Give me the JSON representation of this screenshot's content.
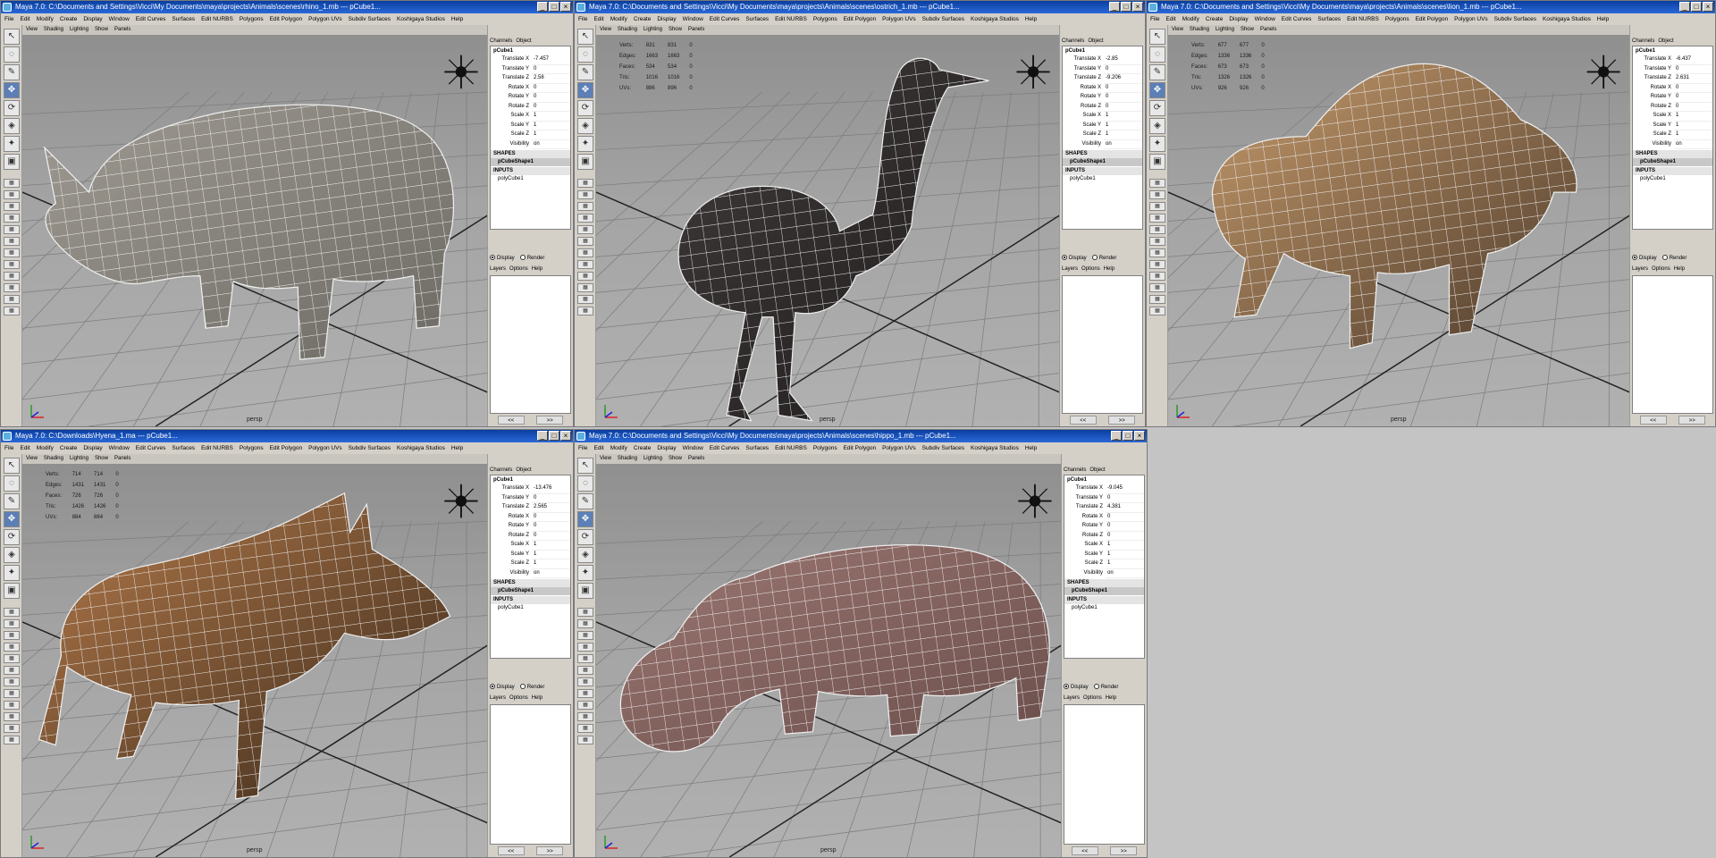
{
  "menus": [
    "File",
    "Edit",
    "Modify",
    "Create",
    "Display",
    "Window",
    "Edit Curves",
    "Surfaces",
    "Edit NURBS",
    "Polygons",
    "Edit Polygon",
    "Polygon UVs",
    "Subdiv Surfaces",
    "Koshigaya Studios",
    "Help"
  ],
  "viewport_menu": [
    "View",
    "Shading",
    "Lighting",
    "Show",
    "Panels"
  ],
  "camera_label": "persp",
  "channel_tabs": [
    "Channels",
    "Object"
  ],
  "object_name": "pCube1",
  "shapes_label": "SHAPES",
  "shape_name": "pCubeShape1",
  "inputs_label": "INPUTS",
  "input_name": "polyCube1",
  "attr_labels": [
    "Translate X",
    "Translate Y",
    "Translate Z",
    "Rotate X",
    "Rotate Y",
    "Rotate Z",
    "Scale X",
    "Scale Y",
    "Scale Z",
    "Visibility"
  ],
  "layer_radio": [
    "Display",
    "Render"
  ],
  "layer_menu": [
    "Layers",
    "Options",
    "Help"
  ],
  "nav_arrows": [
    "<<",
    ">>"
  ],
  "hud_labels": [
    "Verts:",
    "Edges:",
    "Faces:",
    "Tris:",
    "UVs:"
  ],
  "windows": [
    {
      "title": "Maya 7.0: C:\\Documents and Settings\\Vicci\\My Documents\\maya\\projects\\Animals\\scenes\\rhino_1.mb  ---  pCube1...",
      "hud": null,
      "attrs": [
        "-7.457",
        "0",
        "2.58",
        "0",
        "0",
        "0",
        "1",
        "1",
        "1",
        "on"
      ],
      "animal": "rhino",
      "colors": {
        "body": "#9e9a92",
        "shade": "#6d6a64"
      }
    },
    {
      "title": "Maya 7.0: C:\\Documents and Settings\\Vicci\\My Documents\\maya\\projects\\Animals\\scenes\\ostrich_1.mb  ---  pCube1...",
      "hud": [
        [
          "831",
          "831",
          "0"
        ],
        [
          "1663",
          "1663",
          "0"
        ],
        [
          "534",
          "534",
          "0"
        ],
        [
          "1016",
          "1016",
          "0"
        ],
        [
          "896",
          "896",
          "0"
        ]
      ],
      "attrs": [
        "-2.85",
        "0",
        "-9.206",
        "0",
        "0",
        "0",
        "1",
        "1",
        "1",
        "on"
      ],
      "animal": "ostrich",
      "colors": {
        "body": "#3f3b3a",
        "shade": "#1f1c1c"
      }
    },
    {
      "title": "Maya 7.0: C:\\Documents and Settings\\Vicci\\My Documents\\maya\\projects\\Animals\\scenes\\lion_1.mb  ---  pCube1...",
      "hud": [
        [
          "677",
          "677",
          "0"
        ],
        [
          "1336",
          "1336",
          "0"
        ],
        [
          "673",
          "673",
          "0"
        ],
        [
          "1326",
          "1326",
          "0"
        ],
        [
          "926",
          "926",
          "0"
        ]
      ],
      "attrs": [
        "-6.437",
        "0",
        "2.631",
        "0",
        "0",
        "0",
        "1",
        "1",
        "1",
        "on"
      ],
      "animal": "lion",
      "colors": {
        "body": "#c59a6b",
        "shade": "#4d3b2c"
      }
    },
    {
      "title": "Maya 7.0: C:\\Downloads\\Hyena_1.ma  ---  pCube1...",
      "hud": [
        [
          "714",
          "714",
          "0"
        ],
        [
          "1431",
          "1431",
          "0"
        ],
        [
          "726",
          "726",
          "0"
        ],
        [
          "1426",
          "1426",
          "0"
        ],
        [
          "884",
          "884",
          "0"
        ]
      ],
      "attrs": [
        "-13.476",
        "0",
        "2.565",
        "0",
        "0",
        "0",
        "1",
        "1",
        "1",
        "on"
      ],
      "animal": "hyena",
      "colors": {
        "body": "#b47a4a",
        "shade": "#3a2a1c"
      }
    },
    {
      "title": "Maya 7.0: C:\\Documents and Settings\\Vicci\\My Documents\\maya\\projects\\Animals\\scenes\\hippo_1.mb  ---  pCube1...",
      "hud": null,
      "attrs": [
        "-9.045",
        "0",
        "4.381",
        "0",
        "0",
        "0",
        "1",
        "1",
        "1",
        "on"
      ],
      "animal": "hippo",
      "colors": {
        "body": "#9b7671",
        "shade": "#6a4e4b"
      }
    }
  ]
}
